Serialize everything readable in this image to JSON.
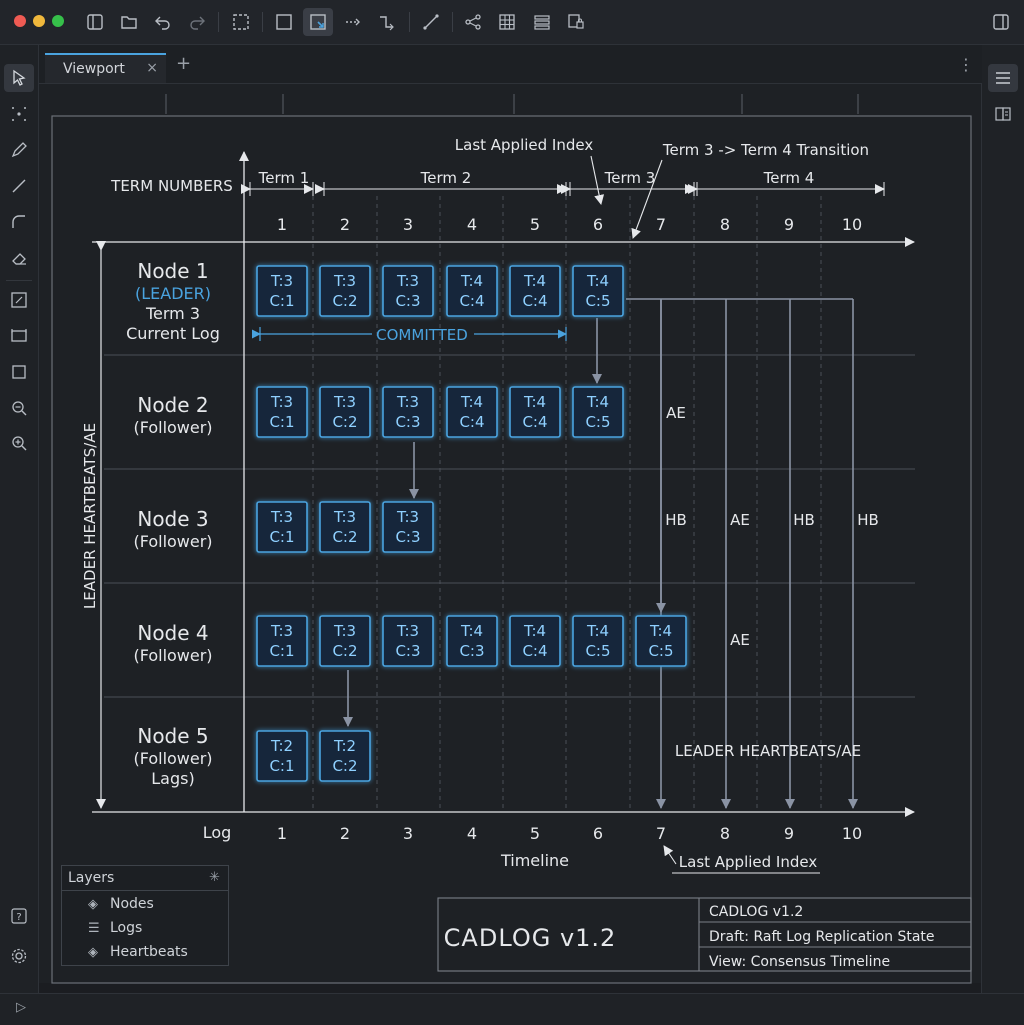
{
  "tab": {
    "label": "Viewport",
    "close": "×",
    "new": "+",
    "more": "⋮"
  },
  "diagram": {
    "term_numbers_label": "TERM NUMBERS",
    "terms": [
      "Term 1",
      "Term 2",
      "Term 3",
      "Term 4"
    ],
    "indices": [
      "1",
      "2",
      "3",
      "4",
      "5",
      "6",
      "7",
      "8",
      "9",
      "10"
    ],
    "last_applied_top": "Last Applied Index",
    "transition": "Term 3 -> Term 4 Transition",
    "committed": "COMMITTED",
    "side_label": "LEADER HEARTBEATS/AE",
    "bottom_right_label": "LEADER HEARTBEATS/AE",
    "log_label": "Log",
    "timeline_label": "Timeline",
    "last_applied_bottom": "Last Applied Index",
    "nodes": [
      {
        "lines": [
          "Node 1",
          "(LEADER)",
          "Term 3",
          "Current Log"
        ],
        "highlight": 1
      },
      {
        "lines": [
          "Node 2",
          "(Follower)"
        ]
      },
      {
        "lines": [
          "Node 3",
          "(Follower)"
        ]
      },
      {
        "lines": [
          "Node 4",
          "(Follower)"
        ]
      },
      {
        "lines": [
          "Node 5",
          "(Follower)",
          "Lags)"
        ]
      }
    ],
    "entries": [
      [
        [
          "T:3",
          "C:1"
        ],
        [
          "T:3",
          "C:2"
        ],
        [
          "T:3",
          "C:3"
        ],
        [
          "T:4",
          "C:4"
        ],
        [
          "T:4",
          "C:4"
        ],
        [
          "T:4",
          "C:5"
        ]
      ],
      [
        [
          "T:3",
          "C:1"
        ],
        [
          "T:3",
          "C:2"
        ],
        [
          "T:3",
          "C:3"
        ],
        [
          "T:4",
          "C:4"
        ],
        [
          "T:4",
          "C:4"
        ],
        [
          "T:4",
          "C:5"
        ]
      ],
      [
        [
          "T:3",
          "C:1"
        ],
        [
          "T:3",
          "C:2"
        ],
        [
          "T:3",
          "C:3"
        ]
      ],
      [
        [
          "T:3",
          "C:1"
        ],
        [
          "T:3",
          "C:2"
        ],
        [
          "T:3",
          "C:3"
        ],
        [
          "T:4",
          "C:3"
        ],
        [
          "T:4",
          "C:4"
        ],
        [
          "T:4",
          "C:5"
        ],
        [
          "T:4",
          "C:5"
        ]
      ],
      [
        [
          "T:2",
          "C:1"
        ],
        [
          "T:2",
          "C:2"
        ]
      ]
    ],
    "msg_labels": {
      "ae": "AE",
      "hb": "HB"
    }
  },
  "title_block": {
    "title": "CADLOG v1.2",
    "line1": "CADLOG v1.2",
    "line2": "Draft: Raft Log Replication State",
    "line3": "View: Consensus Timeline"
  },
  "layers": {
    "title": "Layers",
    "items": [
      "Nodes",
      "Logs",
      "Heartbeats"
    ]
  }
}
